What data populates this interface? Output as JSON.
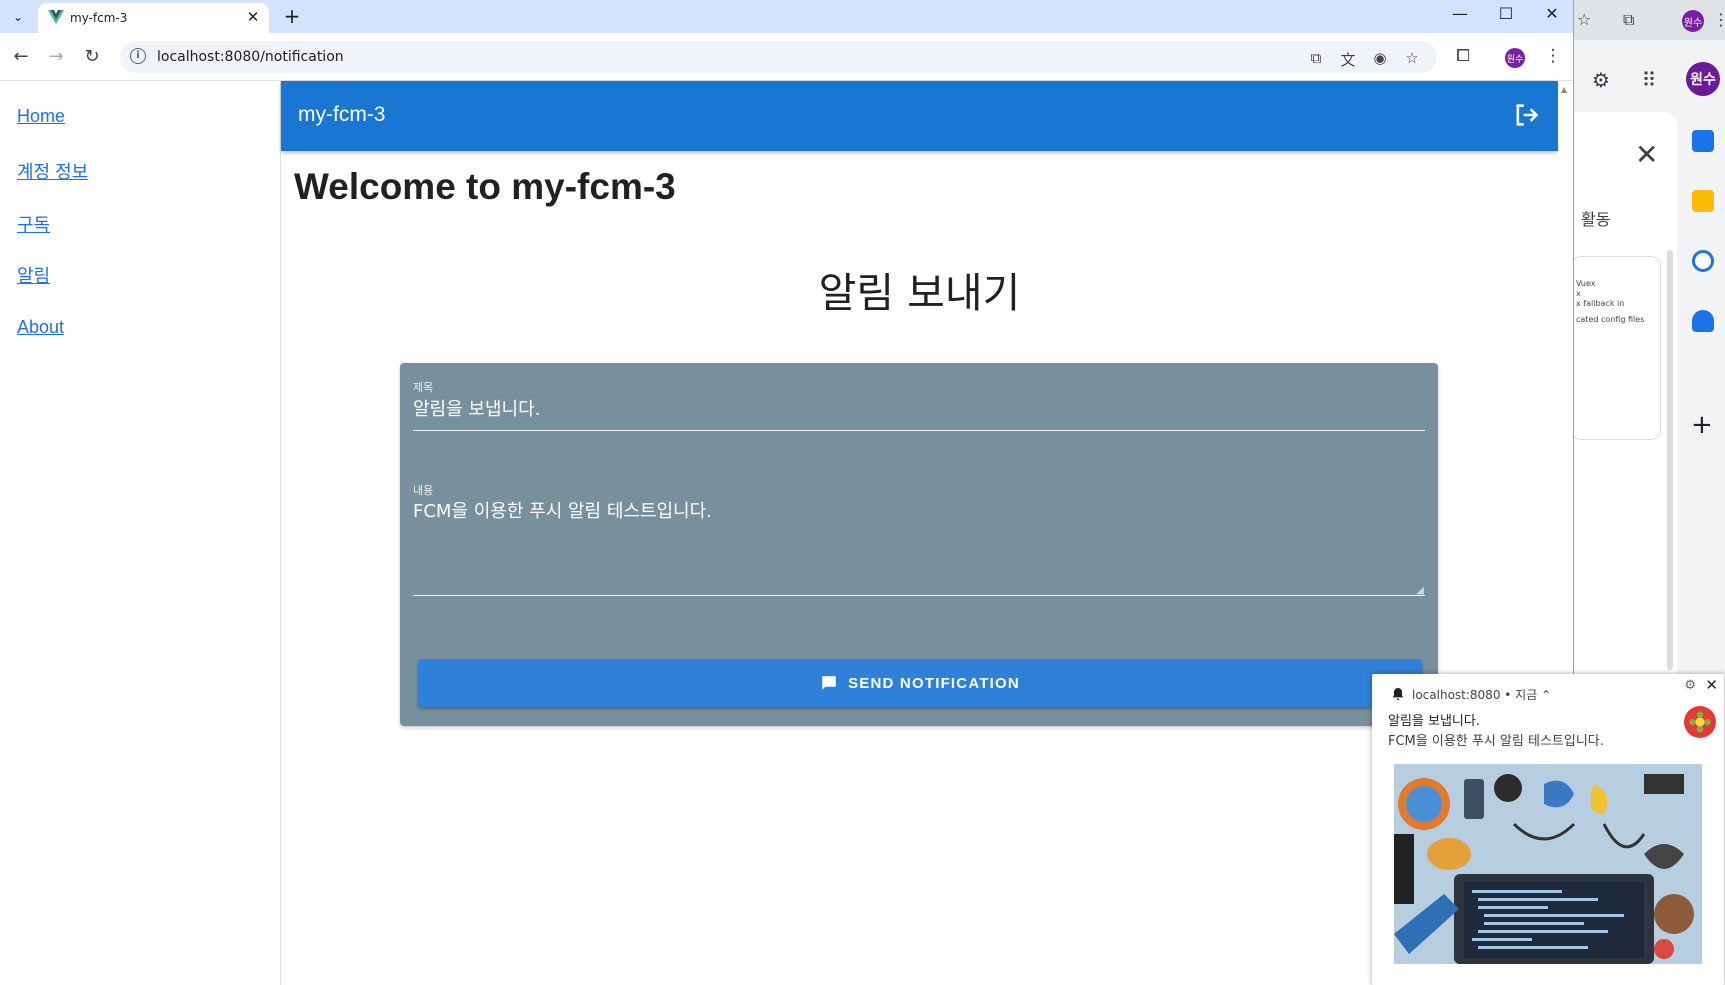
{
  "browser": {
    "tab_title": "my-fcm-3",
    "url": "localhost:8080/notification",
    "profile_initials": "원수"
  },
  "sidebar": {
    "items": [
      {
        "label": "Home"
      },
      {
        "label": "계정 정보"
      },
      {
        "label": "구독"
      },
      {
        "label": "알림"
      },
      {
        "label": "About"
      }
    ]
  },
  "appbar": {
    "title": "my-fcm-3",
    "accent_color": "#1976d2"
  },
  "main": {
    "welcome": "Welcome to my-fcm-3",
    "section_title": "알림 보내기",
    "form": {
      "title_label": "제목",
      "title_value": "알림을 보냅니다.",
      "content_label": "내용",
      "content_value": "FCM을 이용한 푸시 알림 테스트입니다.",
      "send_button": "SEND NOTIFICATION",
      "card_color": "#78909c"
    }
  },
  "toast": {
    "origin": "localhost:8080",
    "time": "지금",
    "title": "알림을 보냅니다.",
    "body": "FCM을 이용한 푸시 알림 테스트입니다."
  },
  "background_app": {
    "activity_label": "활동",
    "profile_initials": "원수",
    "card_lines": [
      "Vuex",
      "x",
      "x fallback in",
      "cated config files"
    ]
  }
}
